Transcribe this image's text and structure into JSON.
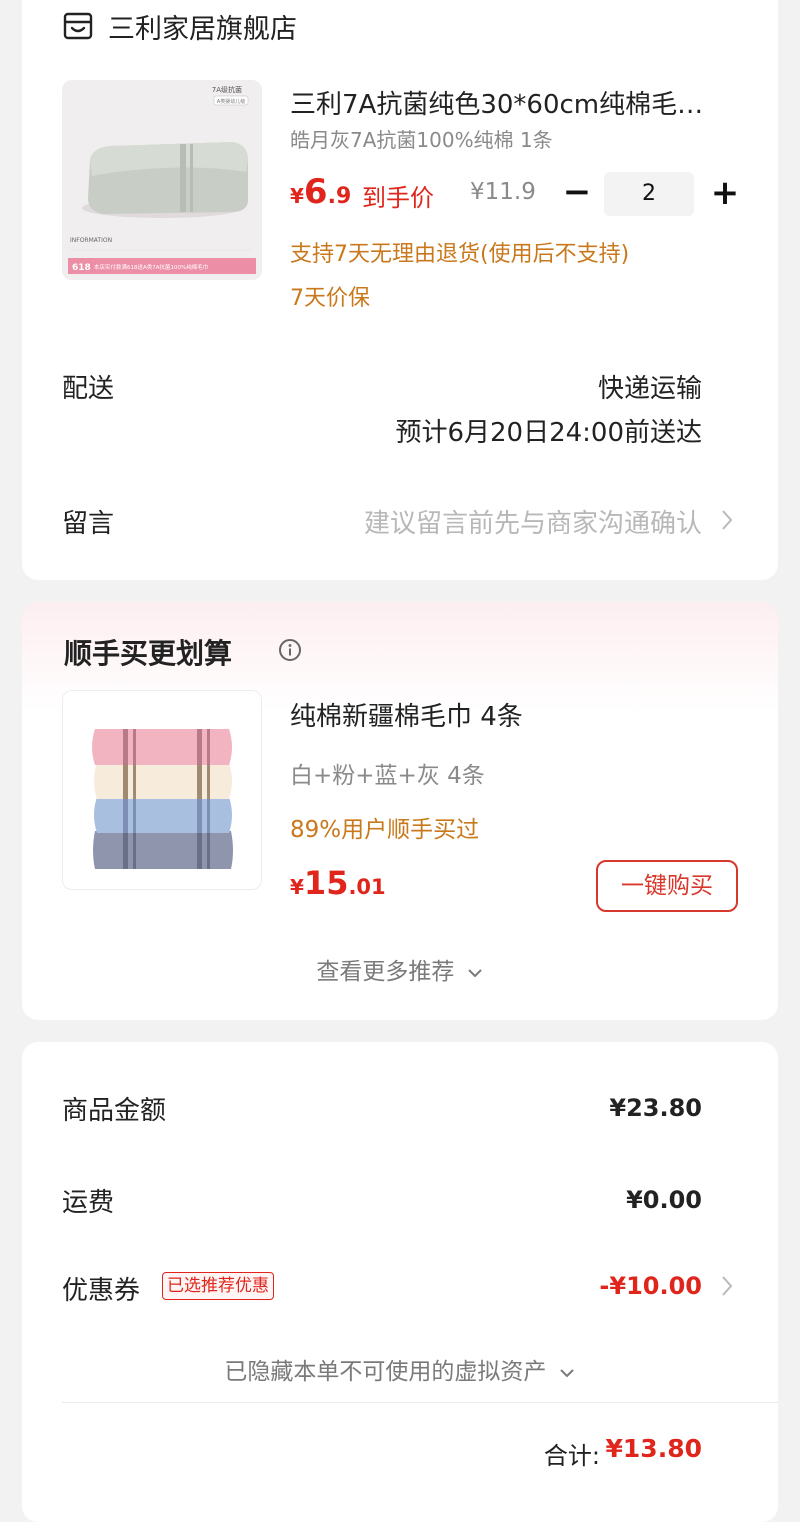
{
  "shop": {
    "name": "三利家居旗舰店",
    "icon": "shop-icon"
  },
  "product": {
    "title": "三利7A抗菌纯色30*60cm纯棉毛…",
    "sku": "皓月灰7A抗菌100%纯棉 1条",
    "price_currency": "¥",
    "price_int": "6",
    "price_dec": ".9",
    "price_tag": "到手价",
    "original_price": "¥11.9",
    "quantity": "2",
    "minus_symbol": "−",
    "plus_symbol": "+",
    "promo_return": "支持7天无理由退货(使用后不支持)",
    "promo_price_protect": "7天价保",
    "image": {
      "badge": "7A级抗菌",
      "badge_sub": "A类婴幼儿级",
      "info": "INFORMATION",
      "banner_num": "618",
      "banner_text": "本店实付款满618送A类7A抗菌100%纯棉毛巾"
    }
  },
  "delivery": {
    "label": "配送",
    "method": "快递运输",
    "eta": "预计6月20日24:00前送达"
  },
  "note": {
    "label": "留言",
    "placeholder": "建议留言前先与商家沟通确认"
  },
  "recommend": {
    "title": "顺手买更划算",
    "item_name": "纯棉新疆棉毛巾 4条",
    "item_sku": "白+粉+蓝+灰 4条",
    "social_proof": "89%用户顺手买过",
    "price_currency": "¥",
    "price_int": "15",
    "price_dec": ".01",
    "buy_label": "一键购买",
    "more_label": "查看更多推荐"
  },
  "summary": {
    "goods_label": "商品金额",
    "goods_value": "¥23.80",
    "shipping_label": "运费",
    "shipping_value": "¥0.00",
    "coupon_label": "优惠券",
    "coupon_badge": "已选推荐优惠",
    "coupon_value": "-¥10.00",
    "hidden_assets": "已隐藏本单不可使用的虚拟资产",
    "total_label": "合计:",
    "total_value": "¥13.80"
  },
  "colors": {
    "accent_red": "#e0261c",
    "promo_orange": "#c9781c",
    "background": "#f2f2f2"
  }
}
